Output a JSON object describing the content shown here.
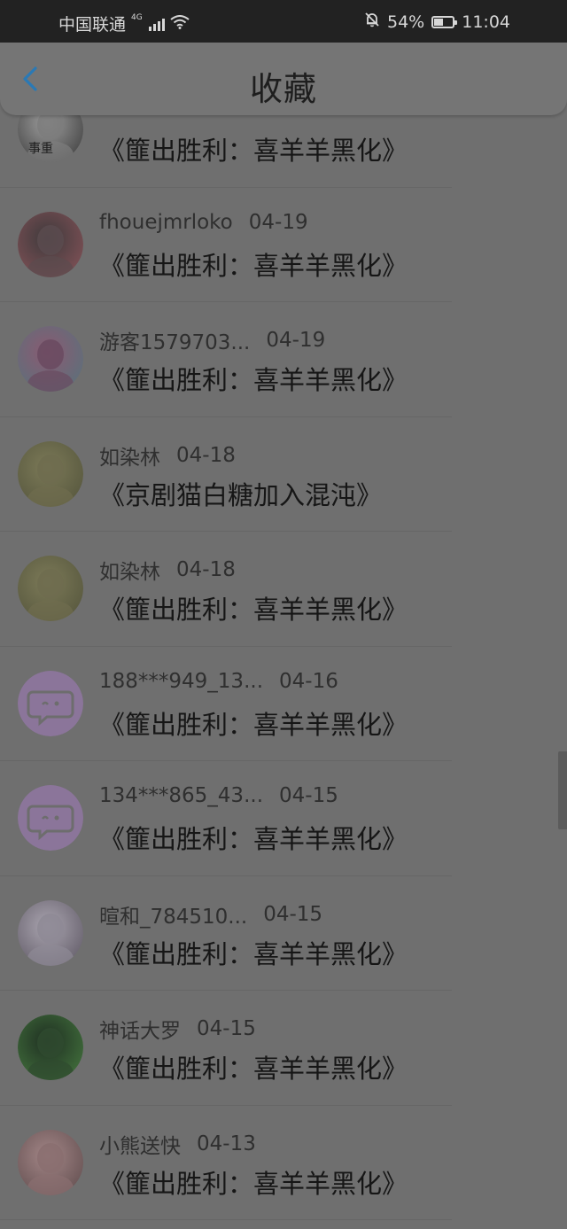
{
  "status_bar": {
    "carrier": "中国联通",
    "network": "4G",
    "battery_percent": "54%",
    "time": "11:04",
    "icons": [
      "signal-icon",
      "wifi-icon",
      "bell-muted-icon",
      "battery-icon"
    ]
  },
  "header": {
    "title": "收藏",
    "back_icon": "chevron-left-icon"
  },
  "items": [
    {
      "name": "",
      "date": "",
      "title": "《篚出胜利：喜羊羊黑化》",
      "avatar": "photo-poster",
      "avatar_text": "事重"
    },
    {
      "name": "fhouejmrloko",
      "date": "04-19",
      "title": "《篚出胜利：喜羊羊黑化》",
      "avatar": "photo-anime"
    },
    {
      "name": "游客1579703...",
      "date": "04-19",
      "title": "《篚出胜利：喜羊羊黑化》",
      "avatar": "photo-anime"
    },
    {
      "name": "如染林",
      "date": "04-18",
      "title": "《京剧猫白糖加入混沌》",
      "avatar": "photo-anime"
    },
    {
      "name": "如染林",
      "date": "04-18",
      "title": "《篚出胜利：喜羊羊黑化》",
      "avatar": "photo-anime"
    },
    {
      "name": "188***949_13...",
      "date": "04-16",
      "title": "《篚出胜利：喜羊羊黑化》",
      "avatar": "default-chat-avatar"
    },
    {
      "name": "134***865_43...",
      "date": "04-15",
      "title": "《篚出胜利：喜羊羊黑化》",
      "avatar": "default-chat-avatar"
    },
    {
      "name": "暄和_784510...",
      "date": "04-15",
      "title": "《篚出胜利：喜羊羊黑化》",
      "avatar": "photo-anime"
    },
    {
      "name": "神话大罗",
      "date": "04-15",
      "title": "《篚出胜利：喜羊羊黑化》",
      "avatar": "photo-anime"
    },
    {
      "name": "小熊送快",
      "date": "04-13",
      "title": "《篚出胜利：喜羊羊黑化》",
      "avatar": "photo-anime"
    }
  ],
  "colors": {
    "accent": "#2a79b5",
    "overlay_background": "#6f6f6f",
    "default_avatar": "#8b759a"
  }
}
